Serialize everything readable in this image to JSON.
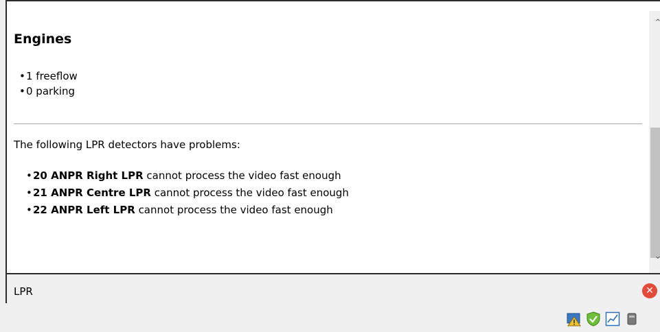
{
  "content": {
    "engines_heading": "Engines",
    "engines_items": [
      "1 freeflow",
      "0 parking"
    ],
    "intro": "The following LPR detectors have problems:",
    "problems": [
      {
        "detector": "20 ANPR Right LPR",
        "message": "cannot process the video fast enough"
      },
      {
        "detector": "21 ANPR Centre LPR",
        "message": "cannot process the video fast enough"
      },
      {
        "detector": "22 ANPR Left LPR",
        "message": "cannot process the video fast enough"
      }
    ]
  },
  "footer": {
    "title": "LPR",
    "close_icon": "close-circle-icon"
  },
  "scrollbar": {
    "up_icon": "chevron-up-icon",
    "down_icon": "chevron-down-icon"
  },
  "tray": {
    "icons": [
      "warning-monitor-icon",
      "shield-check-icon",
      "chart-icon",
      "device-icon"
    ]
  },
  "colors": {
    "close": "#e24b3a",
    "shield": "#6fbf3a",
    "chart": "#2f6fb5"
  }
}
